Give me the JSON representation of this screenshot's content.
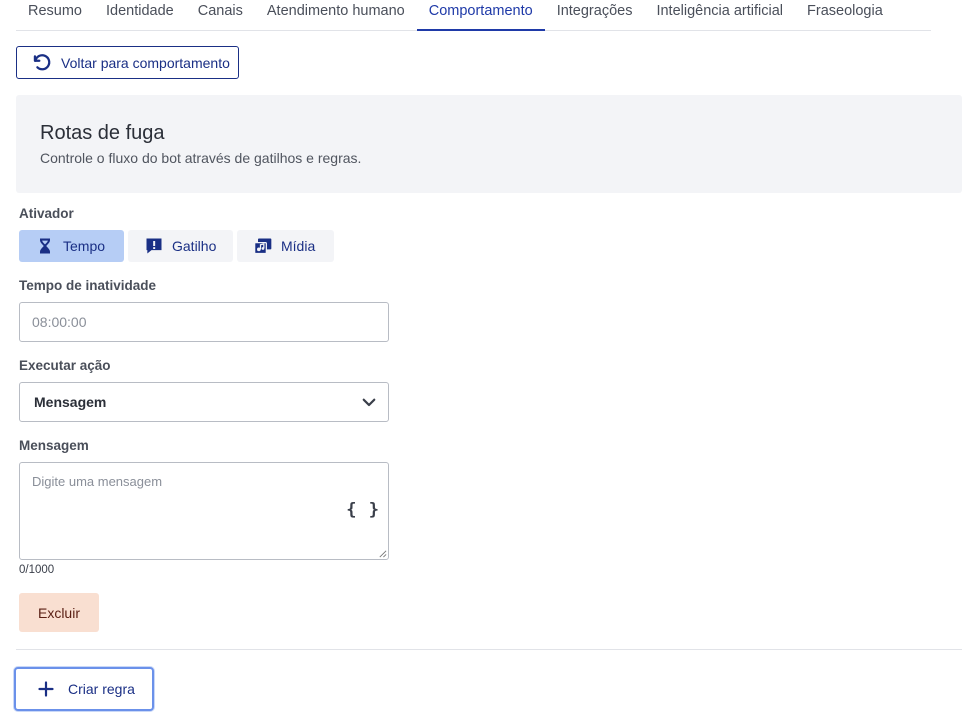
{
  "tabs": [
    {
      "label": "Resumo",
      "active": false
    },
    {
      "label": "Identidade",
      "active": false
    },
    {
      "label": "Canais",
      "active": false
    },
    {
      "label": "Atendimento humano",
      "active": false
    },
    {
      "label": "Comportamento",
      "active": true
    },
    {
      "label": "Integrações",
      "active": false
    },
    {
      "label": "Inteligência artificial",
      "active": false
    },
    {
      "label": "Fraseologia",
      "active": false
    }
  ],
  "back_button": {
    "label": "Voltar para comportamento",
    "icon": "undo-icon"
  },
  "panel": {
    "title": "Rotas de fuga",
    "subtitle": "Controle o fluxo do bot através de gatilhos e regras."
  },
  "activator": {
    "label": "Ativador",
    "options": [
      {
        "label": "Tempo",
        "icon": "hourglass-icon",
        "active": true
      },
      {
        "label": "Gatilho",
        "icon": "alert-message-icon",
        "active": false
      },
      {
        "label": "Mídia",
        "icon": "media-icon",
        "active": false
      }
    ]
  },
  "inactivity": {
    "label": "Tempo de inatividade",
    "placeholder": "08:00:00"
  },
  "action": {
    "label": "Executar ação",
    "selected": "Mensagem"
  },
  "message": {
    "label": "Mensagem",
    "placeholder": "Digite uma mensagem",
    "variables_icon": "{ }",
    "counter": "0/1000"
  },
  "delete_button": {
    "label": "Excluir"
  },
  "create_button": {
    "label": "Criar regra",
    "icon": "plus-icon"
  },
  "colors": {
    "primary": "#1a2f85",
    "active_tab": "#1f3aa8",
    "selected_trigger": "#b6cdf5",
    "danger_bg": "#f9dfd1",
    "panel_bg": "#f3f4f7"
  }
}
